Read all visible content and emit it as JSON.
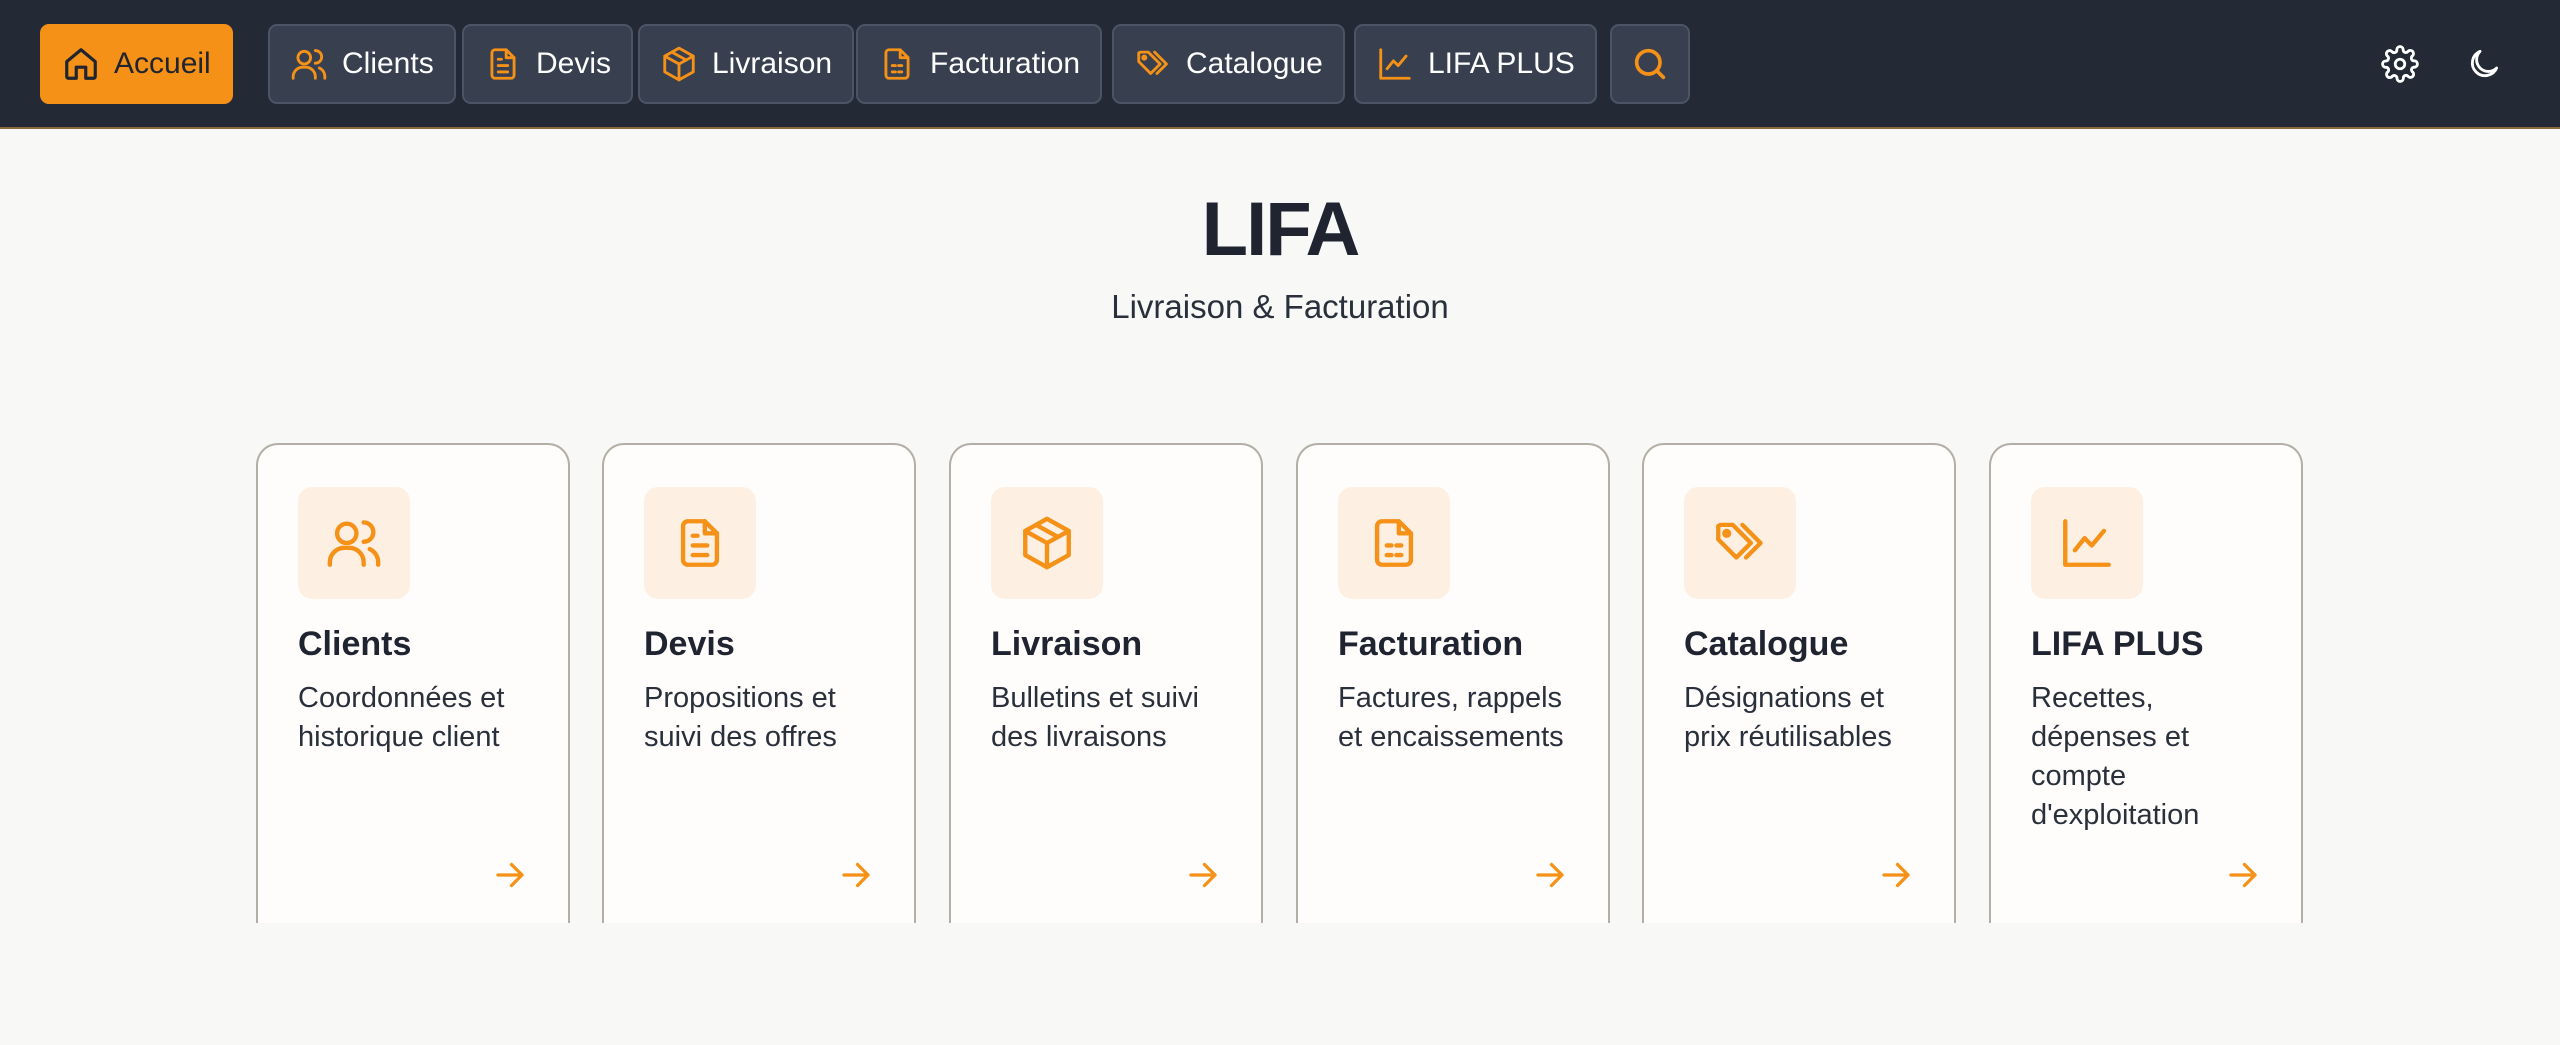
{
  "nav": {
    "items": [
      {
        "label": "Accueil",
        "icon": "home-icon",
        "active": true
      },
      {
        "label": "Clients",
        "icon": "users-icon"
      },
      {
        "label": "Devis",
        "icon": "document-icon"
      },
      {
        "label": "Livraison",
        "icon": "package-icon"
      },
      {
        "label": "Facturation",
        "icon": "invoice-icon"
      },
      {
        "label": "Catalogue",
        "icon": "tags-icon"
      },
      {
        "label": "LIFA PLUS",
        "icon": "chart-line-icon"
      }
    ],
    "search_icon": "search-icon",
    "settings_icon": "gear-icon",
    "theme_icon": "moon-icon"
  },
  "hero": {
    "title": "LIFA",
    "subtitle": "Livraison & Facturation"
  },
  "cards": [
    {
      "title": "Clients",
      "desc": "Coordonnées et historique client",
      "icon": "users-icon"
    },
    {
      "title": "Devis",
      "desc": "Propositions et suivi des offres",
      "icon": "document-icon"
    },
    {
      "title": "Livraison",
      "desc": "Bulletins et suivi des livraisons",
      "icon": "package-icon"
    },
    {
      "title": "Facturation",
      "desc": "Factures, rappels et encaissements",
      "icon": "invoice-icon"
    },
    {
      "title": "Catalogue",
      "desc": "Désignations et prix réutilisables",
      "icon": "tags-icon"
    },
    {
      "title": "LIFA PLUS",
      "desc": "Recettes, dépenses et compte d'exploitation",
      "icon": "chart-line-icon"
    }
  ],
  "colors": {
    "accent": "#f59117",
    "topbar": "#232a36",
    "nav_button": "#384050",
    "page_bg": "#f8f8f6",
    "icon_tile": "#fdefe2"
  }
}
